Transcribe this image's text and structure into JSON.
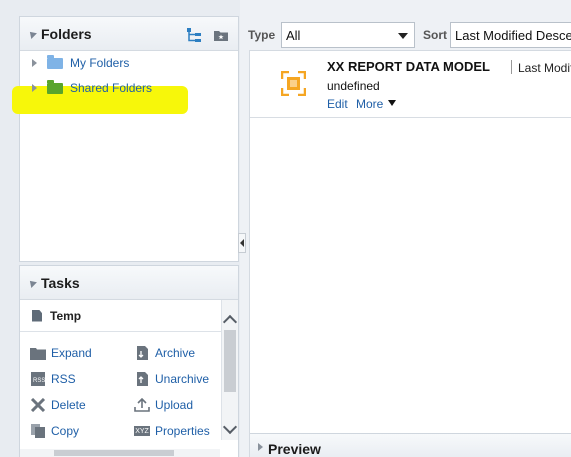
{
  "folders_panel": {
    "title": "Folders",
    "tree": [
      {
        "label": "My Folders",
        "folder_color": "#7fb3e6"
      },
      {
        "label": "Shared Folders",
        "folder_color": "#59a52c"
      }
    ],
    "highlight_color": "#f7f70a",
    "icons": [
      "expand-all-icon",
      "new-folder-icon"
    ]
  },
  "tasks_panel": {
    "title": "Tasks",
    "selected": "Temp",
    "items": [
      {
        "label": "Expand",
        "icon": "folder-icon"
      },
      {
        "label": "Archive",
        "icon": "archive-icon"
      },
      {
        "label": "RSS",
        "icon": "rss-icon"
      },
      {
        "label": "Unarchive",
        "icon": "unarchive-icon"
      },
      {
        "label": "Delete",
        "icon": "delete-icon"
      },
      {
        "label": "Upload",
        "icon": "upload-icon"
      },
      {
        "label": "Copy",
        "icon": "copy-icon"
      },
      {
        "label": "Properties",
        "icon": "properties-icon",
        "icon_text": "XYZ"
      }
    ]
  },
  "toolbar": {
    "type_label": "Type",
    "type_value": "All",
    "sort_label": "Sort",
    "sort_value": "Last Modified Descending"
  },
  "catalog_item": {
    "name": "XX REPORT DATA MODEL",
    "modified_label": "Last Modified",
    "description": "undefined",
    "edit_link": "Edit",
    "more_link": "More",
    "icon_color": "#f5a623"
  },
  "preview": {
    "title": "Preview"
  },
  "colors": {
    "link": "#1f5fa7",
    "accent": "#f5a623"
  }
}
